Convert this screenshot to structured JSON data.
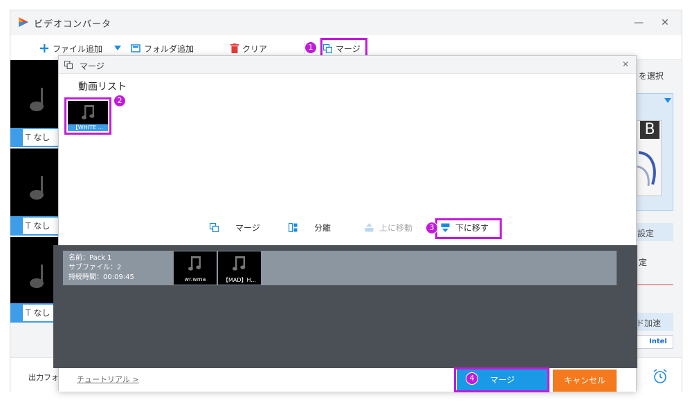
{
  "app": {
    "title": "ビデオコンバータ",
    "minimize": "—",
    "close": "✕"
  },
  "toolbar": {
    "add_file": "ファイル追加",
    "add_folder": "フォルダ追加",
    "clear": "クリア",
    "merge": "マージ"
  },
  "thumbs": [
    {
      "tag": "なし"
    },
    {
      "tag": "なし"
    },
    {
      "tag": "なし"
    }
  ],
  "right_panel": {
    "select_partial": "を選択",
    "settings_partial": "設定",
    "fixed_partial": "定",
    "hw_accel_partial": "ド加速",
    "intel": "Intel",
    "format_preview": "B"
  },
  "bottombar": {
    "output_format_partial": "出力フォ"
  },
  "dialog": {
    "title": "マージ",
    "section": "動画リスト",
    "video_item_caption": "【WHITE ...",
    "actions": {
      "merge": "マージ",
      "split": "分離",
      "move_up": "上に移動",
      "move_down": "下に移す"
    },
    "pack": {
      "name": "名前：Pack 1",
      "subfiles": "サブファイル：2",
      "duration": "持続時間：00:09:45",
      "files": [
        {
          "caption": "wr.wma"
        },
        {
          "caption": "【MAD】H..."
        }
      ]
    },
    "footer": {
      "tutorial": "チュートリアル >",
      "merge": "マージ",
      "cancel": "キャンセル"
    }
  },
  "badges": [
    "1",
    "2",
    "3",
    "4"
  ],
  "colors": {
    "highlight": "#c21bd9",
    "accent_blue": "#1a9ae6",
    "cancel_orange": "#f57a1e",
    "merge_area": "#4b5057"
  }
}
